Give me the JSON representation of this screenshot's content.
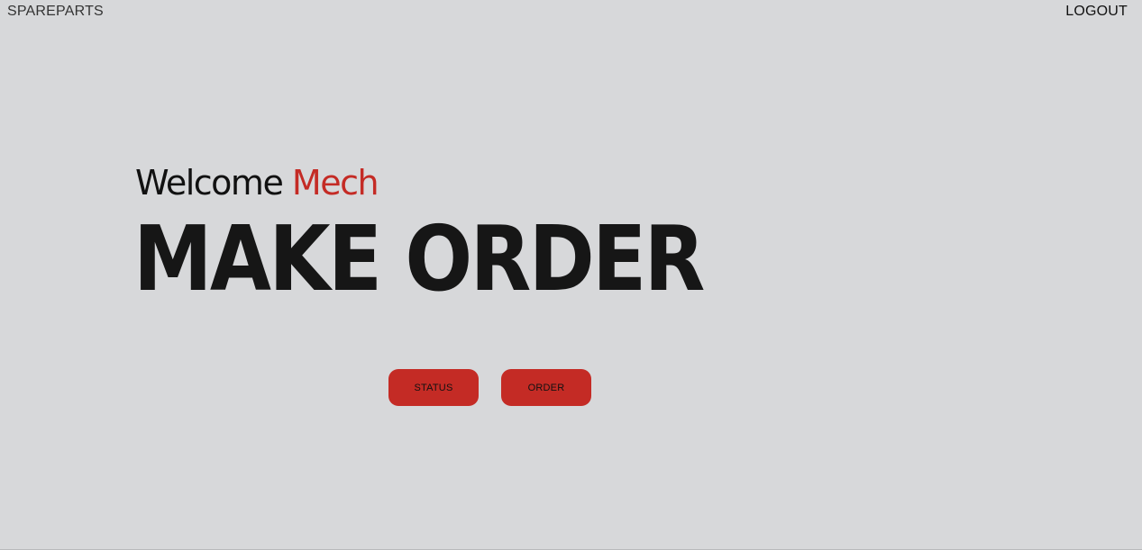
{
  "header": {
    "brand": "SPAREPARTS",
    "logout_label": "LOGOUT"
  },
  "hero": {
    "welcome_prefix": "Welcome",
    "welcome_name": "Mech",
    "headline": "MAKE ORDER"
  },
  "actions": {
    "status_label": "STATUS",
    "order_label": "ORDER"
  },
  "colors": {
    "background": "#d7d8da",
    "accent": "#c42b25",
    "text": "#111111"
  }
}
